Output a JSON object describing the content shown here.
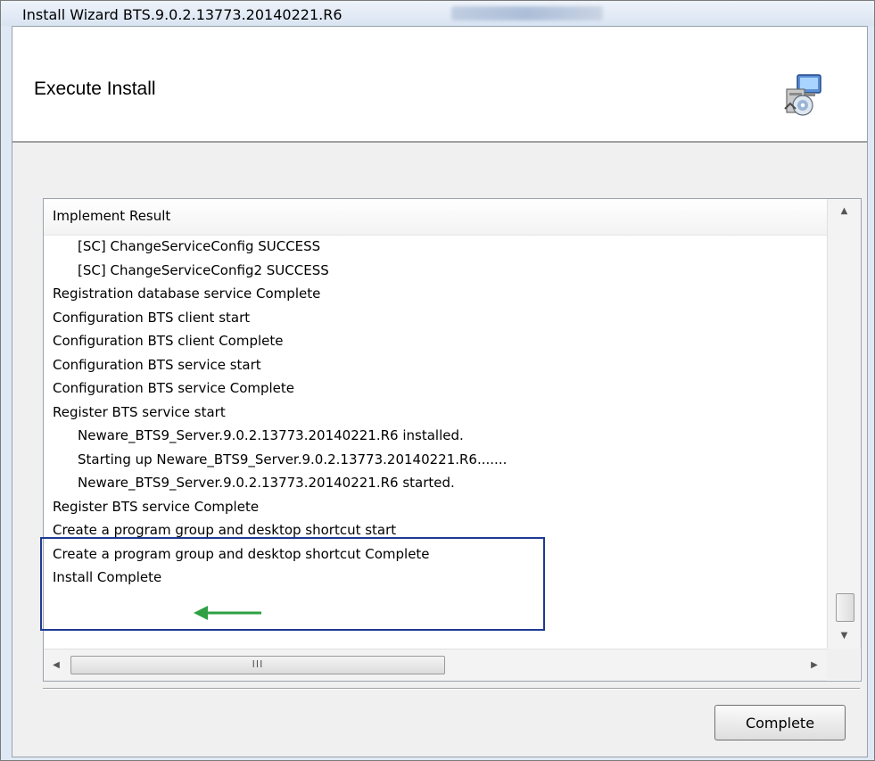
{
  "window": {
    "title": "Install Wizard BTS.9.0.2.13773.20140221.R6"
  },
  "header": {
    "title": "Execute Install",
    "icon": "setup-installer-icon"
  },
  "result_list": {
    "column_header": "Implement Result",
    "rows": [
      {
        "text": "[SC] ChangeServiceConfig SUCCESS"
      },
      {
        "text": "[SC] ChangeServiceConfig2 SUCCESS"
      },
      {
        "text": "Registration database service Complete"
      },
      {
        "text": "Configuration BTS client start"
      },
      {
        "text": "Configuration BTS client Complete"
      },
      {
        "text": "Configuration BTS service start"
      },
      {
        "text": "Configuration BTS service Complete"
      },
      {
        "text": "Register BTS service start"
      },
      {
        "text": "Neware_BTS9_Server.9.0.2.13773.20140221.R6 installed."
      },
      {
        "text": "Starting up Neware_BTS9_Server.9.0.2.13773.20140221.R6......."
      },
      {
        "text": "Neware_BTS9_Server.9.0.2.13773.20140221.R6 started."
      },
      {
        "text": "Register BTS service Complete"
      },
      {
        "text": "Create a program group and desktop shortcut start"
      },
      {
        "text": "Create a program group and desktop shortcut Complete"
      },
      {
        "text": "Install Complete"
      }
    ],
    "hscroll_grip": "III"
  },
  "annotation": {
    "highlight_color": "#1f3a93",
    "arrow_color": "#2ea043"
  },
  "buttons": {
    "complete_label": "Complete"
  }
}
